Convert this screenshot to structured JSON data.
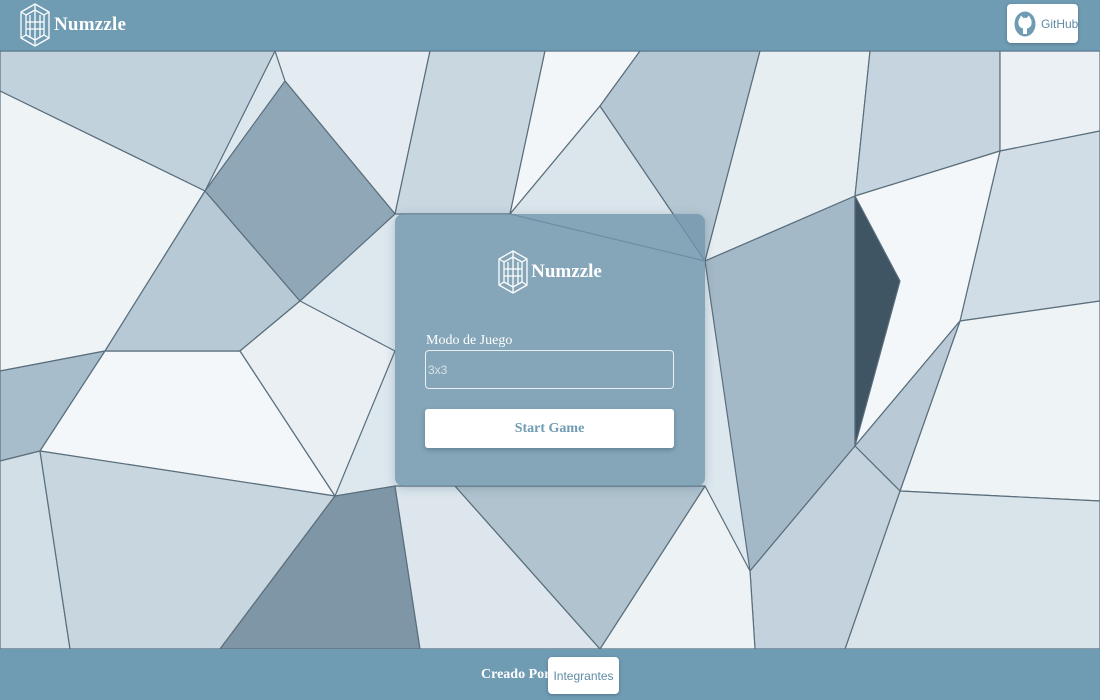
{
  "header": {
    "brand_name": "Numzzle",
    "github_label": "GitHub"
  },
  "card": {
    "brand_name": "Numzzle",
    "mode_label": "Modo de Juego",
    "mode_placeholder": "3x3",
    "mode_value": "",
    "start_label": "Start Game"
  },
  "footer": {
    "credit_label": "Creado Por:",
    "members_label": "Integrantes"
  },
  "icons": {
    "logo": "numzzle-cube-logo-icon",
    "github": "github-octocat-icon"
  },
  "colors": {
    "primary": "#6f9bb3",
    "button_text": "#5f8aa4",
    "card": "#7196ac",
    "background_light": "#dfe8ee"
  }
}
